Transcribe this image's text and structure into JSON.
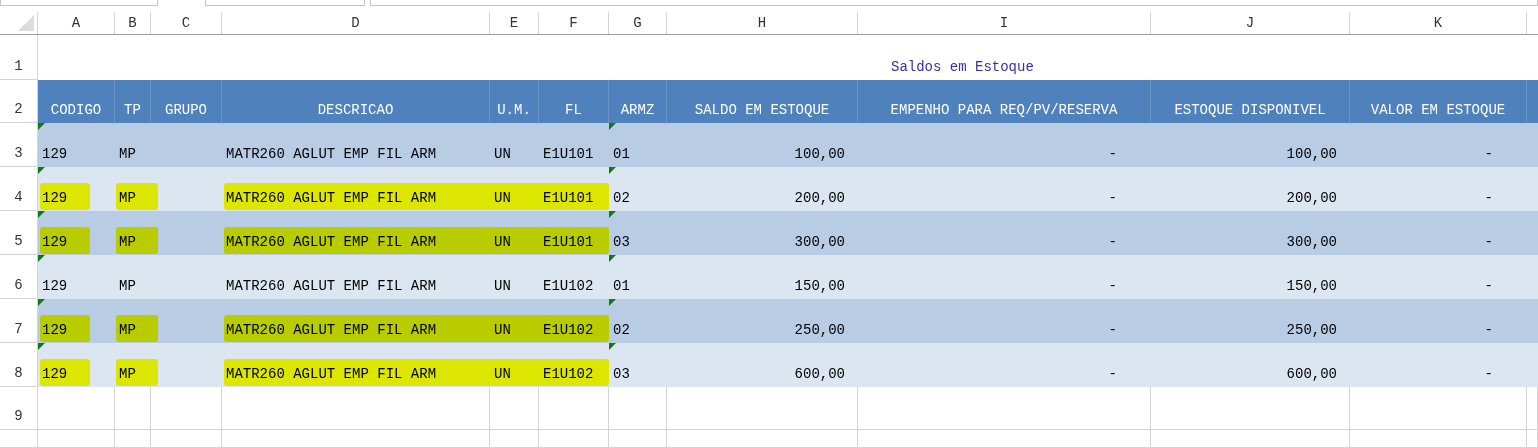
{
  "columns": [
    "A",
    "B",
    "C",
    "D",
    "E",
    "F",
    "G",
    "H",
    "I",
    "J",
    "K"
  ],
  "row_numbers": [
    "1",
    "2",
    "3",
    "4",
    "5",
    "6",
    "7",
    "8",
    "9"
  ],
  "title": "Saldos em Estoque",
  "header": [
    "CODIGO",
    "TP",
    "GRUPO",
    "DESCRICAO",
    "U.M.",
    "FL",
    "ARMZ",
    "SALDO EM ESTOQUE",
    "EMPENHO PARA REQ/PV/RESERVA",
    "ESTOQUE DISPONIVEL",
    "VALOR EM ESTOQUE"
  ],
  "rows": [
    {
      "cells": [
        "129",
        "MP",
        "",
        "MATR260 AGLUT EMP FIL ARM",
        "UN",
        "E1U101",
        "01",
        "100,00",
        "-",
        "100,00",
        "-"
      ],
      "highlighted": false,
      "text_warning": true
    },
    {
      "cells": [
        "129",
        "MP",
        "",
        "MATR260 AGLUT EMP FIL ARM",
        "UN",
        "E1U101",
        "02",
        "200,00",
        "-",
        "200,00",
        "-"
      ],
      "highlighted": true,
      "text_warning": true
    },
    {
      "cells": [
        "129",
        "MP",
        "",
        "MATR260 AGLUT EMP FIL ARM",
        "UN",
        "E1U101",
        "03",
        "300,00",
        "-",
        "300,00",
        "-"
      ],
      "highlighted": true,
      "text_warning": true
    },
    {
      "cells": [
        "129",
        "MP",
        "",
        "MATR260 AGLUT EMP FIL ARM",
        "UN",
        "E1U102",
        "01",
        "150,00",
        "-",
        "150,00",
        "-"
      ],
      "highlighted": false,
      "text_warning": true
    },
    {
      "cells": [
        "129",
        "MP",
        "",
        "MATR260 AGLUT EMP FIL ARM",
        "UN",
        "E1U102",
        "02",
        "250,00",
        "-",
        "250,00",
        "-"
      ],
      "highlighted": true,
      "text_warning": true
    },
    {
      "cells": [
        "129",
        "MP",
        "",
        "MATR260 AGLUT EMP FIL ARM",
        "UN",
        "E1U102",
        "03",
        "600,00",
        "-",
        "600,00",
        "-"
      ],
      "highlighted": true,
      "text_warning": true
    }
  ]
}
